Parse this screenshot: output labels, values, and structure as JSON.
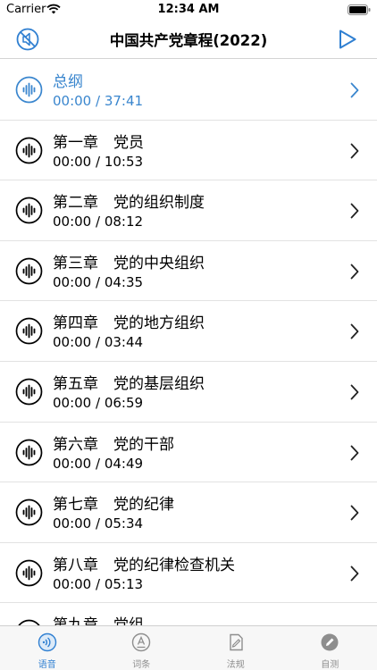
{
  "status": {
    "carrier": "Carrier",
    "time": "12:34 AM"
  },
  "nav": {
    "title": "中国共产党章程(2022)",
    "left_icon": "no-sound-icon",
    "right_icon": "play-icon"
  },
  "colors": {
    "accent": "#3a86ce",
    "text": "#000000",
    "tab_inactive": "#8e8e8e"
  },
  "chapters": [
    {
      "title": "总纲",
      "time": "00:00 / 37:41",
      "active": true
    },
    {
      "title": "第一章　党员",
      "time": "00:00 / 10:53"
    },
    {
      "title": "第二章　党的组织制度",
      "time": "00:00 / 08:12"
    },
    {
      "title": "第三章　党的中央组织",
      "time": "00:00 / 04:35"
    },
    {
      "title": "第四章　党的地方组织",
      "time": "00:00 / 03:44"
    },
    {
      "title": "第五章　党的基层组织",
      "time": "00:00 / 06:59"
    },
    {
      "title": "第六章　党的干部",
      "time": "00:00 / 04:49"
    },
    {
      "title": "第七章　党的纪律",
      "time": "00:00 / 05:34"
    },
    {
      "title": "第八章　党的纪律检查机关",
      "time": "00:00 / 05:13"
    },
    {
      "title": "第九章　党组",
      "time": ""
    }
  ],
  "tabs": [
    {
      "label": "语音",
      "icon": "voice-icon",
      "active": true
    },
    {
      "label": "词条",
      "icon": "entry-icon"
    },
    {
      "label": "法规",
      "icon": "regulation-icon"
    },
    {
      "label": "自测",
      "icon": "pencil-icon"
    }
  ]
}
